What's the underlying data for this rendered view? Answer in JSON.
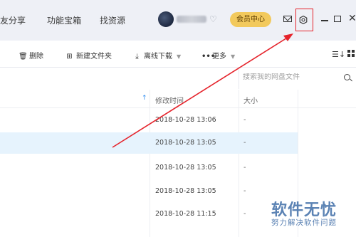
{
  "nav": {
    "items": [
      "友分享",
      "功能宝箱",
      "找资源"
    ]
  },
  "account": {
    "vip_label": "会员中心"
  },
  "window_controls": {
    "minimize": "—",
    "close": "✕"
  },
  "toolbar": {
    "delete_label": "删除",
    "new_folder_label": "新建文件夹",
    "offline_download_label": "离线下载",
    "more_label": "更多"
  },
  "search": {
    "placeholder": "搜索我的网盘文件"
  },
  "table": {
    "columns": {
      "modified": "修改时间",
      "size": "大小"
    },
    "rows": [
      {
        "modified": "2018-10-28 13:06",
        "size": "-",
        "selected": false
      },
      {
        "modified": "2018-10-28 13:05",
        "size": "-",
        "selected": true
      },
      {
        "modified": "2018-10-28 13:05",
        "size": "-",
        "selected": false
      },
      {
        "modified": "2018-10-28 13:05",
        "size": "-",
        "selected": false
      },
      {
        "modified": "2018-10-28 11:15",
        "size": "-",
        "selected": false
      }
    ]
  },
  "watermark": {
    "title": "软件无忧",
    "subtitle": "努力解决软件问题"
  },
  "colors": {
    "highlight_box": "#e5232b",
    "selected_row": "#e6f3fd",
    "vip_button": "#f2c95c",
    "sort_arrow": "#2f8cf0"
  }
}
